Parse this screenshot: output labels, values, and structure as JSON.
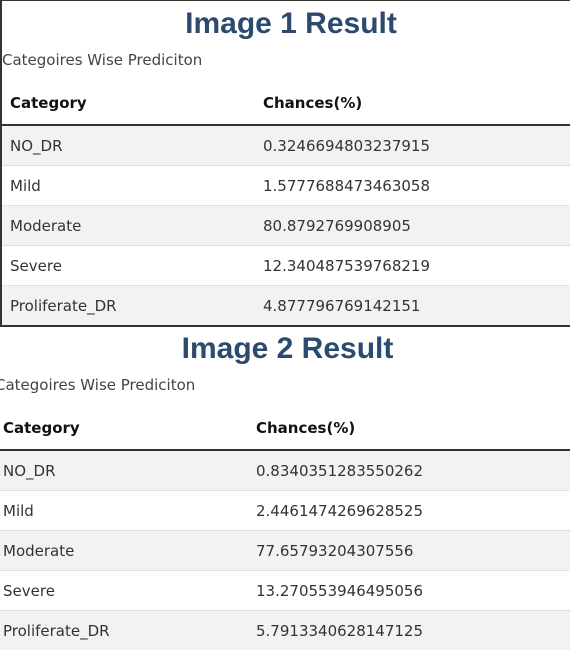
{
  "results": [
    {
      "title": "Image 1 Result",
      "subtitle": "Categoires Wise Prediciton",
      "headers": {
        "category": "Category",
        "chances": "Chances(%)"
      },
      "rows": [
        {
          "category": "NO_DR",
          "chance": "0.3246694803237915"
        },
        {
          "category": "Mild",
          "chance": "1.5777688473463058"
        },
        {
          "category": "Moderate",
          "chance": "80.8792769908905"
        },
        {
          "category": "Severe",
          "chance": "12.340487539768219"
        },
        {
          "category": "Proliferate_DR",
          "chance": "4.877796769142151"
        }
      ]
    },
    {
      "title": "Image 2 Result",
      "subtitle": "Categoires Wise Prediciton",
      "headers": {
        "category": "Category",
        "chances": "Chances(%)"
      },
      "rows": [
        {
          "category": "NO_DR",
          "chance": "0.8340351283550262"
        },
        {
          "category": "Mild",
          "chance": "2.4461474269628525"
        },
        {
          "category": "Moderate",
          "chance": "77.65793204307556"
        },
        {
          "category": "Severe",
          "chance": "13.270553946495056"
        },
        {
          "category": "Proliferate_DR",
          "chance": "5.7913340628147125"
        }
      ]
    }
  ]
}
